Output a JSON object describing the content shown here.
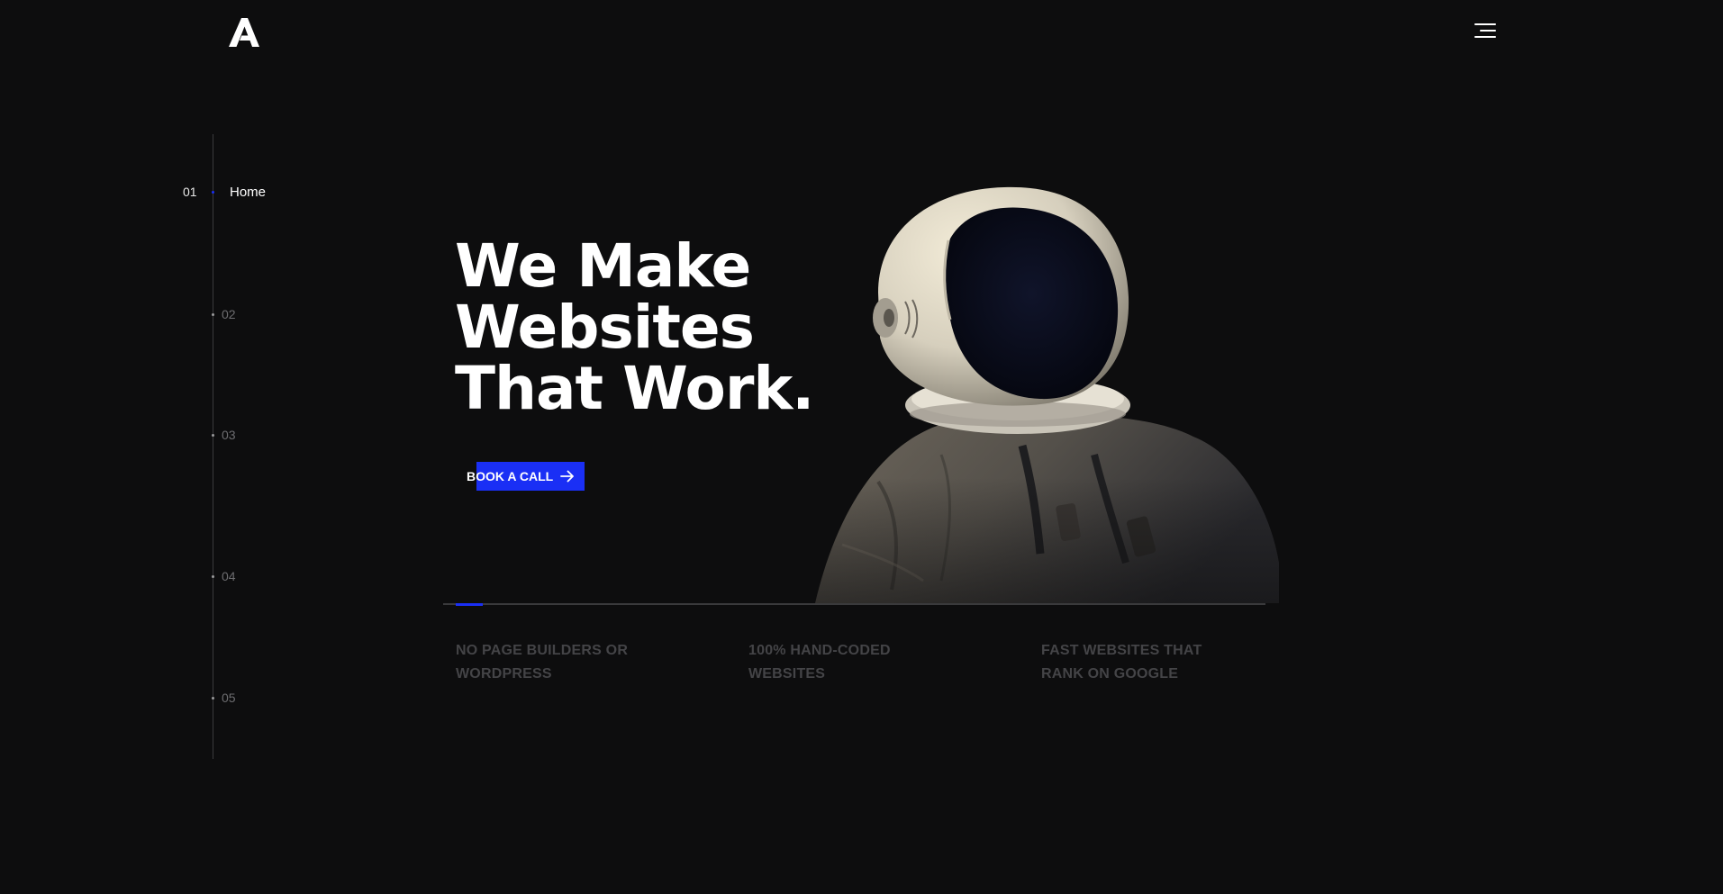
{
  "header": {
    "logo_icon": "logo-a-icon",
    "menu_icon": "hamburger-menu-icon"
  },
  "section_nav": {
    "items": [
      {
        "number": "01",
        "label": "Home",
        "active": true
      },
      {
        "number": "02",
        "label": "",
        "active": false
      },
      {
        "number": "03",
        "label": "",
        "active": false
      },
      {
        "number": "04",
        "label": "",
        "active": false
      },
      {
        "number": "05",
        "label": "",
        "active": false
      }
    ]
  },
  "hero": {
    "title_line1": "We Make",
    "title_line2": "Websites",
    "title_line3": "That Work.",
    "cta_label": "BOOK A CALL",
    "cta_icon": "arrow-right-icon",
    "image": "astronaut-illustration"
  },
  "features": [
    "NO PAGE BUILDERS OR WORDPRESS",
    "100% HAND-CODED WEBSITES",
    "FAST WEBSITES THAT RANK ON GOOGLE"
  ],
  "colors": {
    "background": "#0d0d0e",
    "accent": "#1a2ff5",
    "muted_text": "#444447"
  }
}
